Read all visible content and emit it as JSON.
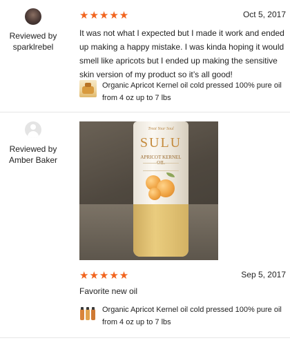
{
  "reviews": [
    {
      "reviewed_by": "Reviewed by",
      "reviewer": "sparklrebel",
      "rating_stars": "★★★★★",
      "rating": 5,
      "date": "Oct 5, 2017",
      "text": "It was not what I expected but I made it work and ended up making a happy mistake. I was kinda hoping it would smell like apricots but I ended up making the sensitive skin version of my product so it’s all good!",
      "product_title": "Organic Apricot Kernel oil cold pressed 100% pure oil from 4 oz up to 7 lbs"
    },
    {
      "reviewed_by": "Reviewed by",
      "reviewer": "Amber Baker",
      "rating_stars": "★★★★★",
      "rating": 5,
      "date": "Sep 5, 2017",
      "text": "Favorite new oil",
      "product_title": "Organic Apricot Kernel oil cold pressed 100% pure oil from 4 oz up to 7 lbs",
      "photo_label": {
        "tagline": "Treat Your Soul",
        "brand": "SULU",
        "product": "APRICOT KERNEL OIL"
      }
    }
  ],
  "colors": {
    "star": "#f1641e",
    "text": "#222222",
    "divider": "#e6e6e6"
  }
}
